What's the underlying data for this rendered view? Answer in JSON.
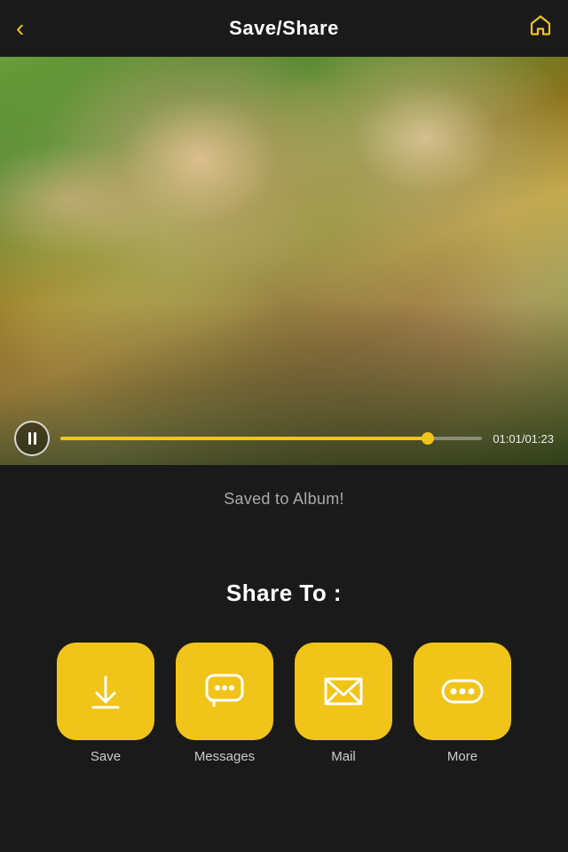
{
  "header": {
    "title": "Save/Share",
    "back_label": "‹",
    "home_label": "⌂"
  },
  "video": {
    "current_time": "01:01",
    "total_time": "01:23",
    "time_display": "01:01/01:23",
    "progress_percent": 87
  },
  "bottom": {
    "saved_text": "Saved to Album!",
    "share_label": "Share To :"
  },
  "share_buttons": [
    {
      "id": "save",
      "label": "Save",
      "icon": "save"
    },
    {
      "id": "messages",
      "label": "Messages",
      "icon": "messages"
    },
    {
      "id": "mail",
      "label": "Mail",
      "icon": "mail"
    },
    {
      "id": "more",
      "label": "More",
      "icon": "more"
    }
  ],
  "colors": {
    "accent": "#f0c419",
    "background": "#1a1a1a",
    "text_white": "#ffffff",
    "text_gray": "#aaaaaa"
  }
}
